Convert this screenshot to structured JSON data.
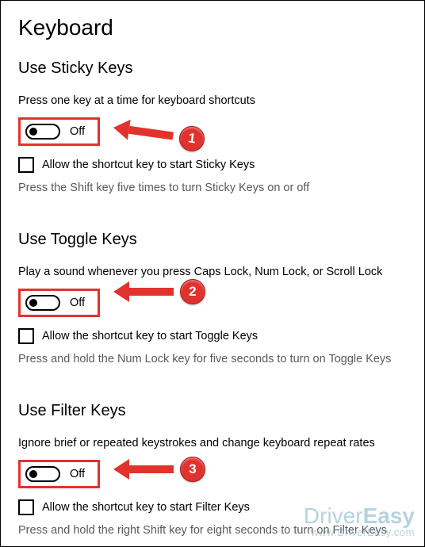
{
  "page": {
    "title": "Keyboard"
  },
  "sections": {
    "sticky": {
      "heading": "Use Sticky Keys",
      "desc": "Press one key at a time for keyboard shortcuts",
      "toggle_state": "Off",
      "checkbox_label": "Allow the shortcut key to start Sticky Keys",
      "hint": "Press the Shift key five times to turn Sticky Keys on or off",
      "step": "1"
    },
    "toggle": {
      "heading": "Use Toggle Keys",
      "desc": "Play a sound whenever you press Caps Lock, Num Lock, or Scroll Lock",
      "toggle_state": "Off",
      "checkbox_label": "Allow the shortcut key to start Toggle Keys",
      "hint": "Press and hold the Num Lock key for five seconds to turn on Toggle Keys",
      "step": "2"
    },
    "filter": {
      "heading": "Use Filter Keys",
      "desc": "Ignore brief or repeated keystrokes and change keyboard repeat rates",
      "toggle_state": "Off",
      "checkbox_label": "Allow the shortcut key to start Filter Keys",
      "hint": "Press and hold the right Shift key for eight seconds to turn on Filter Keys",
      "step": "3"
    }
  },
  "watermark": {
    "brand_light": "Driver",
    "brand_bold": "Easy",
    "url": "www.DriverEasy.com"
  }
}
